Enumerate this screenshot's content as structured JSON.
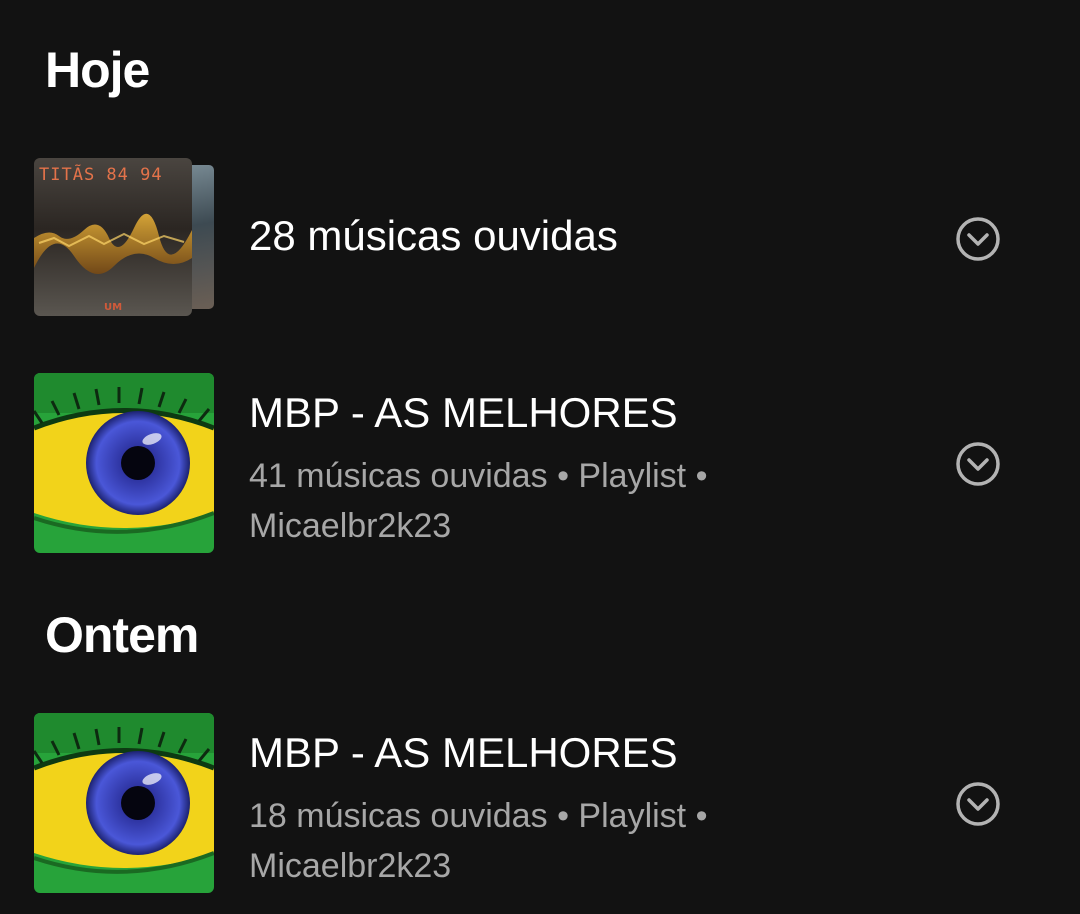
{
  "sections": [
    {
      "title": "Hoje",
      "items": [
        {
          "title": "28 músicas ouvidas",
          "art": {
            "text_top": "TITÃS 84 94",
            "text_bottom": "UM"
          }
        },
        {
          "title": "MBP - AS MELHORES",
          "subtitle_count": "41 músicas ouvidas",
          "subtitle_type": "Playlist",
          "subtitle_owner": "Micaelbr2k23"
        }
      ]
    },
    {
      "title": "Ontem",
      "items": [
        {
          "title": "MBP - AS MELHORES",
          "subtitle_count": "18 músicas ouvidas",
          "subtitle_type": "Playlist",
          "subtitle_owner": "Micaelbr2k23"
        }
      ]
    }
  ],
  "separator": "•",
  "icons": {
    "expand": "chevron-down-circle-icon"
  },
  "colors": {
    "background": "#121212",
    "text_primary": "#ffffff",
    "text_secondary": "#a7a7a7"
  }
}
